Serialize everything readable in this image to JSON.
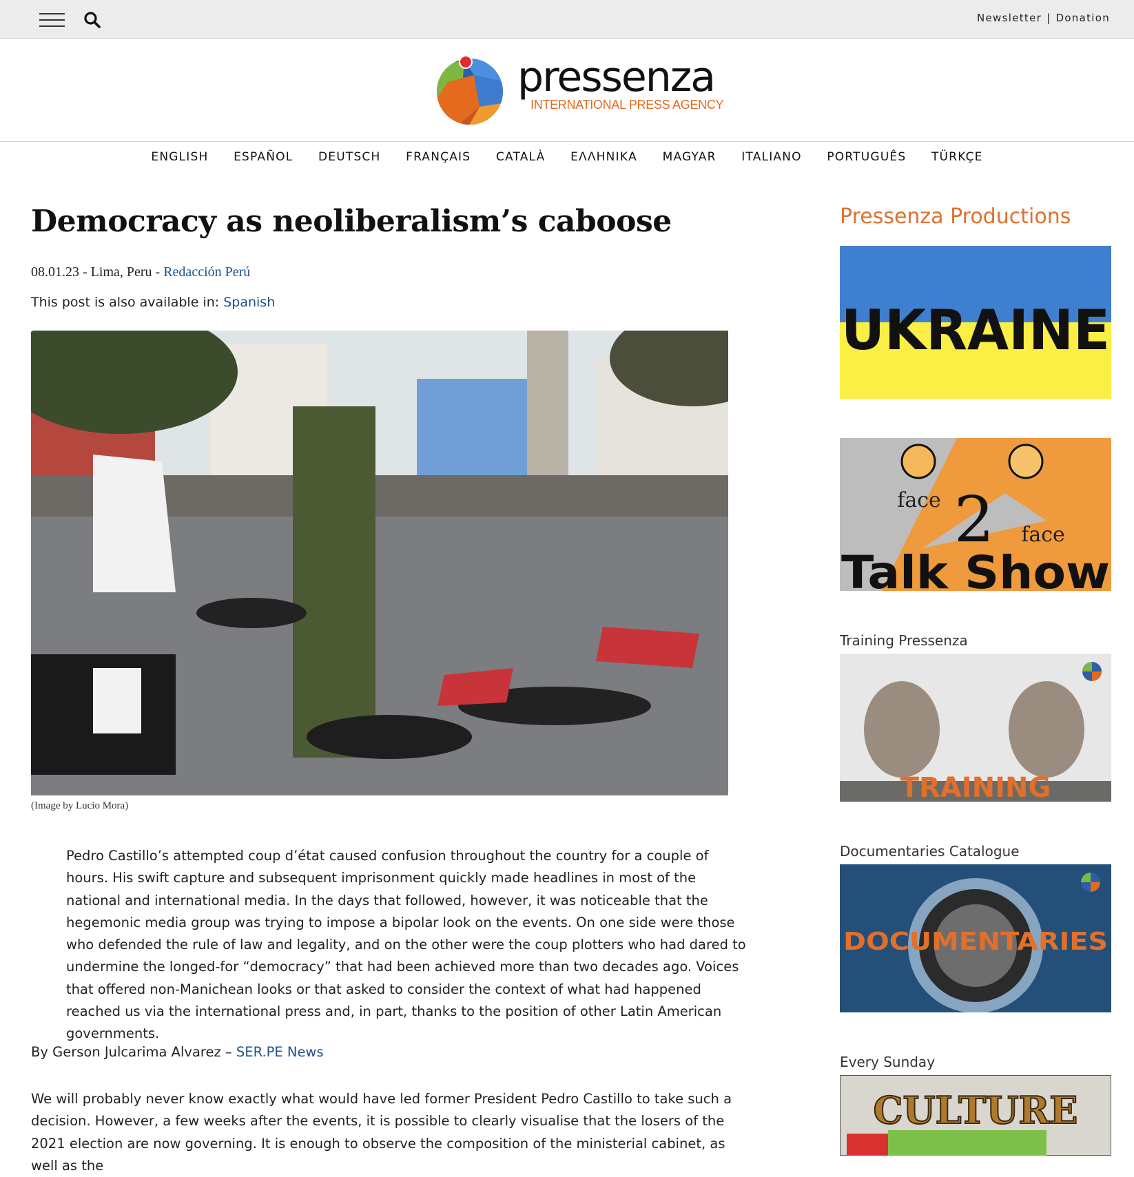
{
  "topbar": {
    "links": [
      "Newsletter",
      "Donation"
    ],
    "separator": "|",
    "icons": [
      "menu-icon",
      "search-icon"
    ]
  },
  "logo": {
    "wordmark": "pressenza",
    "tagline": "INTERNATIONAL PRESS AGENCY",
    "colors": {
      "orange": "#e66a1e",
      "blue": "#2c5fa8",
      "green": "#7db843",
      "red": "#e32b2b"
    }
  },
  "languages": [
    "ENGLISH",
    "ESPAÑOL",
    "DEUTSCH",
    "FRANÇAIS",
    "CATALÀ",
    "ΕΛΛΗΝΙΚΑ",
    "MAGYAR",
    "ITALIANO",
    "PORTUGUÊS",
    "TÜRKÇE"
  ],
  "article": {
    "title": "Democracy as neoliberalism’s caboose",
    "date": "08.01.23",
    "location": "Lima, Peru",
    "author_team": "Redacción Perú",
    "availability_prefix": "This post is also available in:",
    "availability_link": "Spanish",
    "image_caption": "(Image by Lucio Mora)",
    "lede": "Pedro Castillo’s attempted coup d’état caused confusion throughout the country for a couple of hours. His swift capture and subsequent imprisonment quickly made headlines in most of the national and international media. In the days that followed, however, it was noticeable that the hegemonic media group was trying to impose a bipolar look on the events. On one side were those who defended the rule of law and legality, and on the other were the coup plotters who had dared to undermine the longed-for “democracy” that had been achieved more than two decades ago. Voices that offered non-Manichean looks or that asked to consider the context of what had happened reached us via the international press and, in part, thanks to the position of other Latin American governments.",
    "byline_prefix": "By Gerson Julcarima Alvarez –",
    "byline_link": "SER.PE News",
    "body": "We will probably never know exactly what would have led former President Pedro Castillo to take such a decision. However, a few weeks after the events, it is possible to clearly visualise that the losers of the 2021 election are now governing. It is enough to observe the composition of the ministerial cabinet, as well as the"
  },
  "sidebar": {
    "title": "Pressenza Productions",
    "promos": [
      {
        "label": "",
        "banner_text": "UKRAINE"
      },
      {
        "label": "",
        "banner_text": [
          "face",
          "2",
          "face",
          "Talk Show"
        ]
      },
      {
        "label": "Training Pressenza",
        "banner_text": "TRAINING"
      },
      {
        "label": "Documentaries Catalogue",
        "banner_text": "DOCUMENTARIES"
      },
      {
        "label": "Every Sunday",
        "banner_text": "CULTURE"
      }
    ]
  },
  "colors": {
    "link": "#1f4f8f",
    "accent": "#e0702c"
  }
}
